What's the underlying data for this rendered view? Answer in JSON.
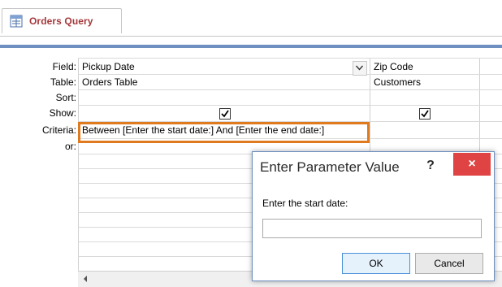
{
  "tab": {
    "label": "Orders Query",
    "icon": "query-icon"
  },
  "row_labels": [
    "Field:",
    "Table:",
    "Sort:",
    "Show:",
    "Criteria:",
    "or:"
  ],
  "columns": [
    {
      "field": "Pickup Date",
      "table": "Orders Table",
      "show": true
    },
    {
      "field": "Zip Code",
      "table": "Customers",
      "show": true
    }
  ],
  "criteria": "Between [Enter the start date:] And [Enter the end date:]",
  "dialog": {
    "title": "Enter Parameter Value",
    "help": "?",
    "close": "×",
    "prompt": "Enter the start date:",
    "input_value": "",
    "ok_label": "OK",
    "cancel_label": "Cancel"
  },
  "colors": {
    "highlight": "#e07a1f",
    "close_button": "#e04343",
    "tab_label": "#a4373a"
  }
}
